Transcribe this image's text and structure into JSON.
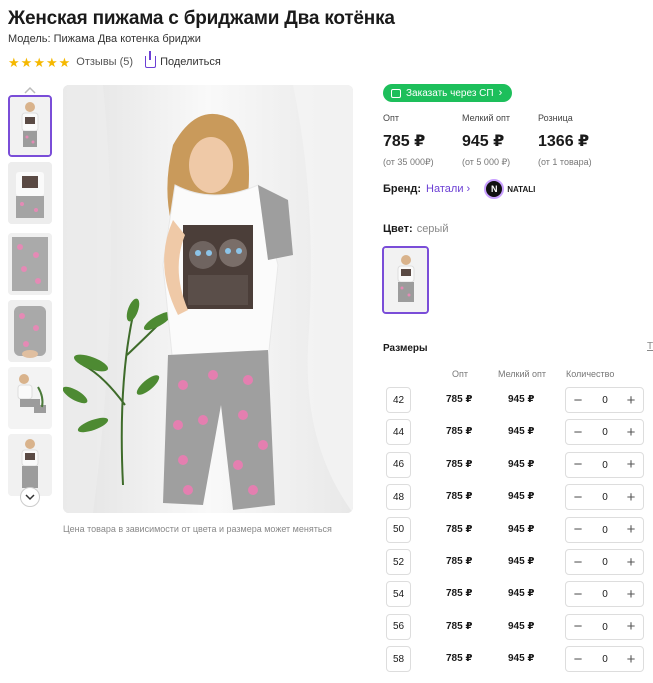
{
  "product": {
    "title": "Женская пижама с бриджами Два котёнка",
    "model": "Модель: Пижама Два котенка бриджи",
    "rating_stars": 5,
    "reviews": "Отзывы (5)",
    "share": "Поделиться"
  },
  "sp_button": "Заказать через СП",
  "prices": [
    {
      "label": "Опт",
      "value": "785 ₽",
      "sub": "(от 35 000₽)"
    },
    {
      "label": "Мелкий опт",
      "value": "945 ₽",
      "sub": "(от 5 000 ₽)"
    },
    {
      "label": "Розница",
      "value": "1366 ₽",
      "sub": "(от 1 товара)"
    }
  ],
  "brand": {
    "label": "Бренд:",
    "name": "Натали",
    "logo_letter": "N",
    "logo_text": "NATALI"
  },
  "color": {
    "label": "Цвет:",
    "value": "серый"
  },
  "caption": "Цена товара в зависимости от цвета и размера может меняться",
  "sizes_table": {
    "title": "Размеры",
    "link": "Т",
    "headers": [
      "Опт",
      "Мелкий опт",
      "Количество"
    ],
    "rows": [
      {
        "size": "42",
        "opt": "785 ₽",
        "small": "945 ₽",
        "qty": "0"
      },
      {
        "size": "44",
        "opt": "785 ₽",
        "small": "945 ₽",
        "qty": "0"
      },
      {
        "size": "46",
        "opt": "785 ₽",
        "small": "945 ₽",
        "qty": "0"
      },
      {
        "size": "48",
        "opt": "785 ₽",
        "small": "945 ₽",
        "qty": "0"
      },
      {
        "size": "50",
        "opt": "785 ₽",
        "small": "945 ₽",
        "qty": "0"
      },
      {
        "size": "52",
        "opt": "785 ₽",
        "small": "945 ₽",
        "qty": "0"
      },
      {
        "size": "54",
        "opt": "785 ₽",
        "small": "945 ₽",
        "qty": "0"
      },
      {
        "size": "56",
        "opt": "785 ₽",
        "small": "945 ₽",
        "qty": "0"
      },
      {
        "size": "58",
        "opt": "785 ₽",
        "small": "945 ₽",
        "qty": "0"
      }
    ]
  },
  "icons": {
    "star": "star-icon",
    "share": "share-icon",
    "cart": "cart-icon",
    "chevron_right": "chevron-right-icon",
    "chevron_down": "chevron-down-icon",
    "chevron_up": "chevron-up-icon",
    "minus": "minus-icon",
    "plus": "plus-icon"
  },
  "colors": {
    "accent": "#7a4dd8",
    "green": "#1dbf5b",
    "star": "#f5b800",
    "link": "#6b3fd4"
  }
}
